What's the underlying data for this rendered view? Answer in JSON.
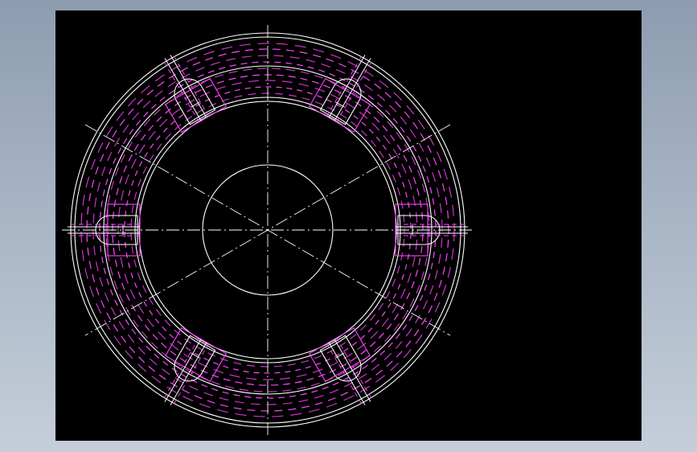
{
  "viewer": {
    "background_color": "#000000",
    "outline_color": "#ffffff",
    "hidden_line_color": "#cc33cc",
    "hidden_line_color_bright": "#ff44ff",
    "centerline_style": "dash-dot",
    "hidden_line_style": "dashed"
  },
  "drawing": {
    "view": "front",
    "part": "ring flange",
    "bolt_holes": 6,
    "bolt_hole_angles_deg": [
      0,
      60,
      120,
      180,
      240,
      300
    ],
    "centerlines": [
      "horizontal",
      "vertical",
      "diagonal-30",
      "diagonal-150"
    ],
    "circles": [
      "outer-rim",
      "outer-rim-inner",
      "bolt-ring-outer",
      "bolt-ring-inner",
      "bore"
    ]
  }
}
